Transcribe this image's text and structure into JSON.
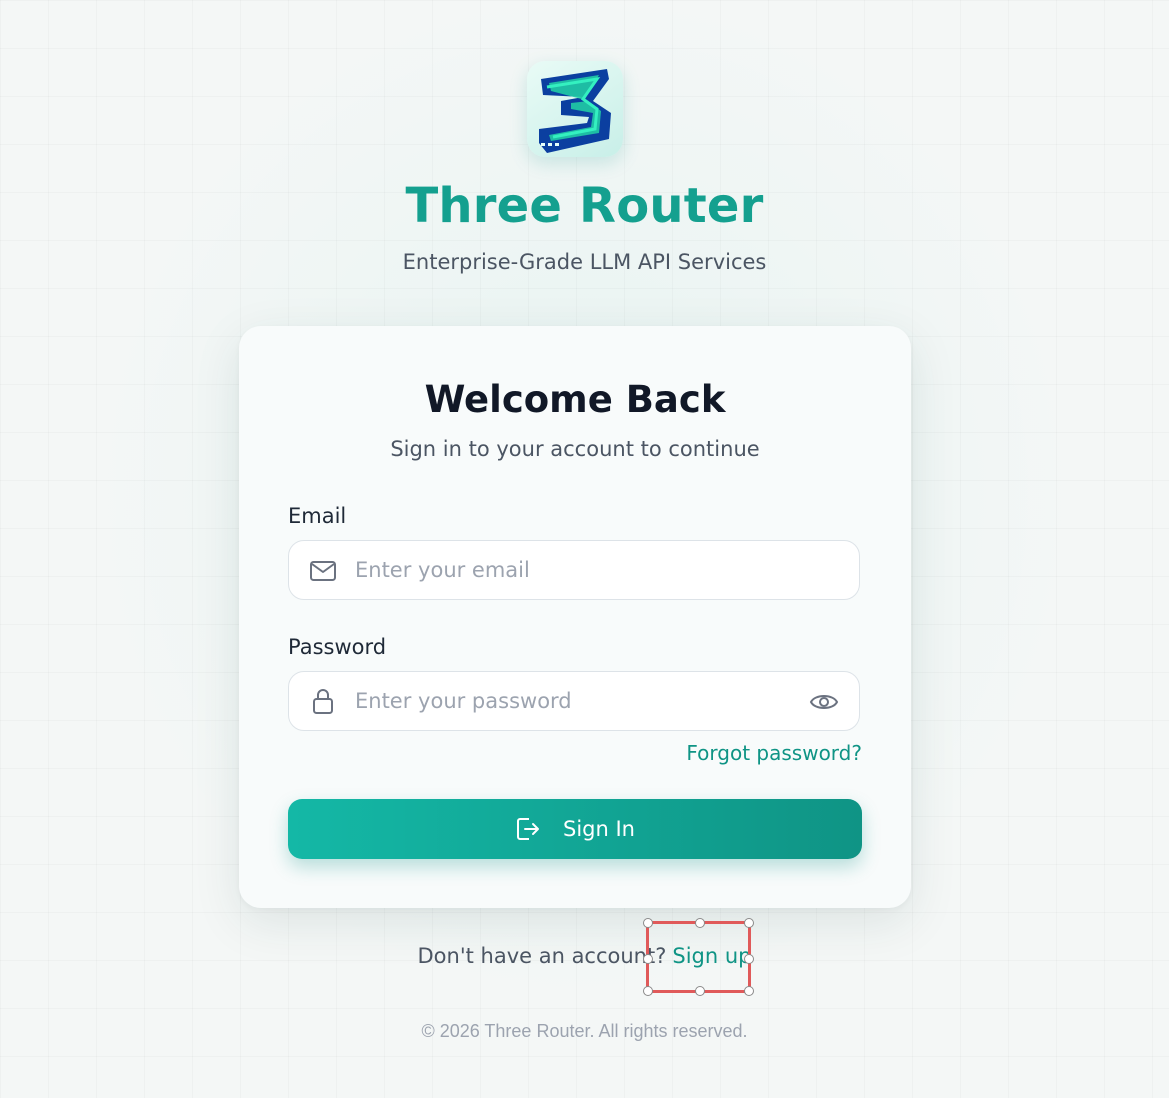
{
  "brand": {
    "logo_icon": "three-router-logo",
    "title": "Three Router",
    "subtitle": "Enterprise-Grade LLM API Services",
    "accent_color": "#14a08f"
  },
  "card": {
    "title": "Welcome Back",
    "subtitle": "Sign in to your account to continue",
    "email": {
      "label": "Email",
      "placeholder": "Enter your email",
      "value": "",
      "icon": "mail-icon"
    },
    "password": {
      "label": "Password",
      "placeholder": "Enter your password",
      "value": "",
      "icon": "lock-icon",
      "toggle_icon": "eye-icon"
    },
    "forgot_label": "Forgot password?",
    "signin_label": "Sign In",
    "signin_icon": "sign-in-icon",
    "button_color": "#14b8a6"
  },
  "signup": {
    "prompt": "Don't have an account?",
    "link_label": "Sign up"
  },
  "footer": {
    "copyright": "© 2026 Three Router. All rights reserved."
  }
}
